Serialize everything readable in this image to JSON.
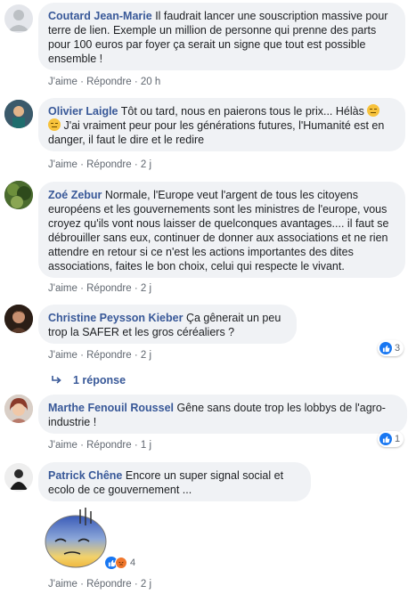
{
  "comments": [
    {
      "author": "Coutard Jean-Marie",
      "text": "Il faudrait lancer une souscription massive pour terre de lien. Exemple un million de personne qui prenne des parts pour 100 euros par foyer ça serait un signe que tout est possible ensemble !",
      "like": "J'aime",
      "reply": "Répondre",
      "time": "20 h"
    },
    {
      "author": "Olivier Laigle",
      "text_before": "Tôt ou tard, nous en paierons tous le prix... Hélàs ",
      "text_after": " J'ai vraiment peur pour les générations futures, l'Humanité est en danger, il faut le dire et le redire",
      "like": "J'aime",
      "reply": "Répondre",
      "time": "2 j"
    },
    {
      "author": "Zoé Zebur",
      "text": "Normale, l'Europe veut l'argent de tous les citoyens européens et les gouvernements sont les ministres de l'europe, vous croyez qu'ils vont nous laisser de quelconques avantages.... il faut se débrouiller sans eux, continuer de donner aux associations et ne rien attendre en retour si ce n'est les actions importantes des dites associations, faites le bon choix, celui qui respecte le vivant.",
      "like": "J'aime",
      "reply": "Répondre",
      "time": "2 j"
    },
    {
      "author": "Christine Peysson Kieber",
      "text": "Ça gênerait un peu trop la SAFER et les gros céréaliers ?",
      "like": "J'aime",
      "reply": "Répondre",
      "time": "2 j",
      "reactions": "3",
      "replies_label": "1 réponse"
    },
    {
      "author": "Marthe Fenouil Roussel",
      "text": "Gêne sans doute trop les lobbys de l'agro-industrie !",
      "like": "J'aime",
      "reply": "Répondre",
      "time": "1 j",
      "reactions": "1"
    },
    {
      "author": "Patrick Chêne",
      "text": "Encore un super signal social et ecolo de ce gouvernement ...",
      "like": "J'aime",
      "reply": "Répondre",
      "time": "2 j",
      "reactions": "4"
    }
  ],
  "separator": "·",
  "colors": {
    "link": "#385898",
    "bubble": "#f0f2f5",
    "like": "#1877f2",
    "angry": "#f0772d"
  }
}
